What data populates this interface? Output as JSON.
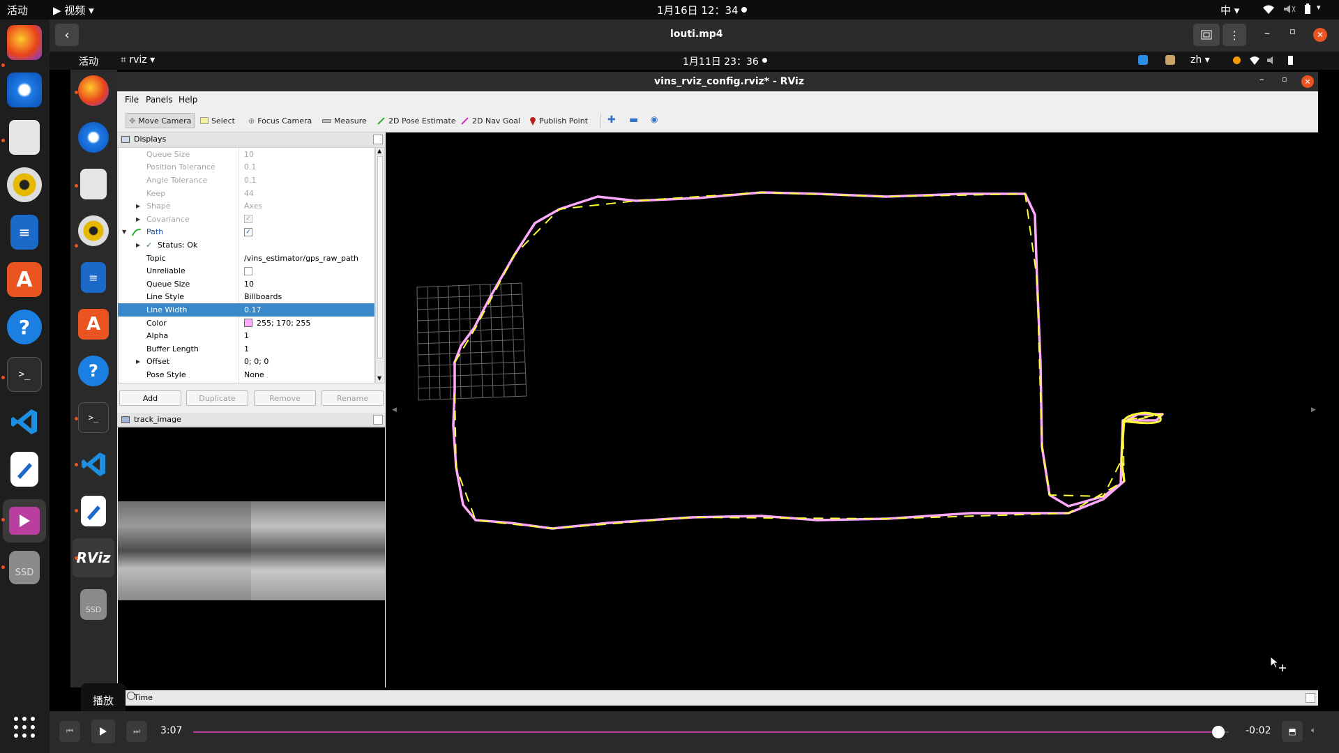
{
  "outer_topbar": {
    "activities": "活动",
    "app_menu": "视频",
    "clock": "1月16日 12：34",
    "input_method": "中"
  },
  "player": {
    "title": "louti.mp4",
    "tooltip": "播放",
    "elapsed": "3:07",
    "remaining": "-0:02",
    "progress": 0.99
  },
  "inner_topbar": {
    "activities": "活动",
    "app_menu": "rviz",
    "clock": "1月11日 23：36",
    "input_method": "zh"
  },
  "outer_dock": {
    "items": [
      "firefox-icon",
      "thunderbird-icon",
      "files-icon",
      "rhythmbox-icon",
      "writer-icon",
      "app-center-icon",
      "help-icon",
      "terminal-icon",
      "vscode-icon",
      "text-editor-icon",
      "video-player-icon",
      "ssd-drive-icon",
      "show-apps-icon"
    ],
    "ssd_label": "SSD"
  },
  "inner_dock": {
    "items": [
      "firefox-icon",
      "thunderbird-icon",
      "files-icon",
      "rhythmbox-icon",
      "writer-icon",
      "app-center-icon",
      "help-icon",
      "terminal-icon",
      "vscode-icon",
      "text-editor-icon",
      "rviz-icon",
      "ssd-drive-icon"
    ],
    "rviz_label": "RViz",
    "ssd_label": "SSD"
  },
  "rviz": {
    "window_title": "vins_rviz_config.rviz* - RViz",
    "menu": [
      "File",
      "Panels",
      "Help"
    ],
    "tools": {
      "move_camera": "Move Camera",
      "select": "Select",
      "focus_camera": "Focus Camera",
      "measure": "Measure",
      "pose_estimate": "2D Pose Estimate",
      "nav_goal": "2D Nav Goal",
      "publish_point": "Publish Point"
    },
    "displays_panel": {
      "title": "Displays",
      "rows": [
        {
          "key": "Queue Size",
          "value": "10",
          "dim": true
        },
        {
          "key": "Position Tolerance",
          "value": "0.1",
          "dim": true
        },
        {
          "key": "Angle Tolerance",
          "value": "0.1",
          "dim": true
        },
        {
          "key": "Keep",
          "value": "44",
          "dim": true
        },
        {
          "key": "Shape",
          "value": "Axes",
          "dim": true
        },
        {
          "key": "Covariance",
          "value": "",
          "dim": true
        },
        {
          "key": "Path",
          "value": ""
        },
        {
          "key": "Status: Ok",
          "value": ""
        },
        {
          "key": "Topic",
          "value": "/vins_estimator/gps_raw_path"
        },
        {
          "key": "Unreliable",
          "value": ""
        },
        {
          "key": "Queue Size",
          "value": "10"
        },
        {
          "key": "Line Style",
          "value": "Billboards"
        },
        {
          "key": "Line Width",
          "value": "0.17"
        },
        {
          "key": "Color",
          "value": "255; 170; 255"
        },
        {
          "key": "Alpha",
          "value": "1"
        },
        {
          "key": "Buffer Length",
          "value": "1"
        },
        {
          "key": "Offset",
          "value": "0; 0; 0"
        },
        {
          "key": "Pose Style",
          "value": "None"
        }
      ],
      "buttons": {
        "add": "Add",
        "duplicate": "Duplicate",
        "remove": "Remove",
        "rename": "Rename"
      }
    },
    "image_panel": {
      "title": "track_image"
    },
    "time_panel": {
      "title": "Time"
    },
    "colors": {
      "path_pink": "#ffaaff",
      "path_yellow": "#ffff33",
      "selection": "#3a87c9"
    }
  }
}
